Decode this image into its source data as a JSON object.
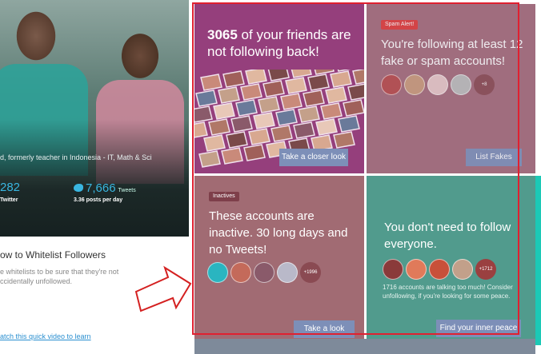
{
  "profile": {
    "bio": "d, formerly teacher in Indonesia - IT, Math & Sci",
    "followers_count": "282",
    "followers_label": "Twitter",
    "tweets_count": "7,666",
    "tweets_label": "Tweets",
    "posts_per_day": "3.36 posts per day"
  },
  "whitelist": {
    "title": "ow to Whitelist Followers",
    "description": "e whitelists to be sure that they're not ccidentally unfollowed.",
    "video_link": "atch this quick video to learn"
  },
  "tiles": {
    "not_following": {
      "count": "3065",
      "text": " of your friends are not following back!",
      "button": "Take a closer look"
    },
    "fakes": {
      "tag": "Spam Alert!",
      "text": "You're following at least 12 fake or spam accounts!",
      "more": "+8",
      "button": "List Fakes"
    },
    "inactives": {
      "tag": "Inactives",
      "text": "These accounts are inactive. 30 long days and no Tweets!",
      "more": "+1996",
      "button": "Take a look"
    },
    "talkers": {
      "text": "You don't need to follow everyone.",
      "more": "+1712",
      "description": "1716 accounts are talking too much! Consider unfollowing, if you're looking for some peace.",
      "button": "Find your inner peace"
    }
  },
  "colors": {
    "tile_not_following": "#953f7c",
    "tile_fakes": "#a36b7a",
    "tile_inactives": "#a16b73",
    "tile_talkers": "#519b8d",
    "button": "#7d8fb8",
    "highlight_frame": "#e02030",
    "twitter_blue": "#39b6e0"
  }
}
